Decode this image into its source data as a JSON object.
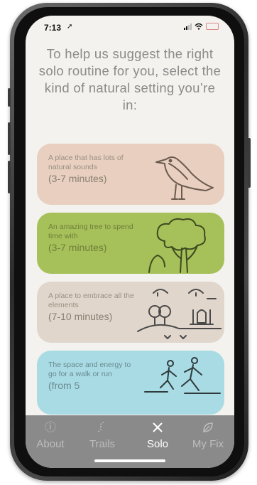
{
  "status_bar": {
    "time": "7:13"
  },
  "prompt": "To help us suggest the right solo routine for you, select the kind of natural setting you’re in:",
  "cards": [
    {
      "title": "A place that has lots of natural sounds",
      "duration": "(3-7 minutes)",
      "icon": "bird-icon"
    },
    {
      "title": "An amazing tree to spend time with",
      "duration": "(3-7 minutes)",
      "icon": "tree-icon"
    },
    {
      "title": "A place to embrace all the elements",
      "duration": "(7-10 minutes)",
      "icon": "elements-icon"
    },
    {
      "title": "The space and energy to go for a walk or run",
      "duration": "(from 5",
      "icon": "runner-icon"
    }
  ],
  "tabs": [
    {
      "label": "About",
      "icon": "info-icon"
    },
    {
      "label": "Trails",
      "icon": "trails-icon"
    },
    {
      "label": "Solo",
      "icon": "close-icon",
      "active": true
    },
    {
      "label": "My Fix",
      "icon": "leaf-icon"
    }
  ],
  "colors": {
    "card1": "#e8cfc0",
    "card2": "#a6c05a",
    "card3": "#e0d6cc",
    "card4": "#a9dbe4",
    "tabbar": "#8a8a8a"
  }
}
